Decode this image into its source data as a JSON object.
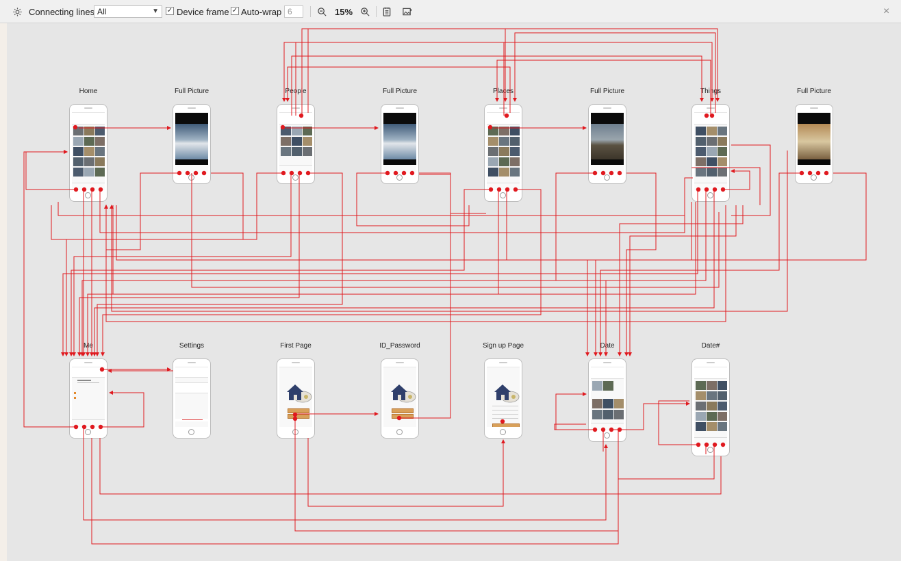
{
  "toolbar": {
    "connecting_lines_label": "Connecting lines",
    "connecting_lines_value": "All",
    "device_frame_label": "Device frame",
    "device_frame_checked": true,
    "auto_wrap_label": "Auto-wrap",
    "auto_wrap_checked": true,
    "auto_wrap_value": "6",
    "zoom_level": "15%",
    "icons": [
      "gear-icon",
      "zoom-out-icon",
      "zoom-in-icon",
      "document-icon",
      "image-export-icon",
      "close-icon"
    ]
  },
  "screens": [
    {
      "label": "Home"
    },
    {
      "label": "Full Picture"
    },
    {
      "label": "People"
    },
    {
      "label": "Full Picture"
    },
    {
      "label": "Places"
    },
    {
      "label": "Full Picture"
    },
    {
      "label": "Things"
    },
    {
      "label": "Full Picture"
    },
    {
      "label": "Me"
    },
    {
      "label": "Settings"
    },
    {
      "label": "First Page"
    },
    {
      "label": "ID_Password"
    },
    {
      "label": "Sign up Page"
    },
    {
      "label": "Date"
    },
    {
      "label": "Date#"
    }
  ],
  "colors": {
    "connector": "#e0191f",
    "toolbar_bg": "#f0f0f0",
    "canvas_bg": "#e6e6e6"
  }
}
